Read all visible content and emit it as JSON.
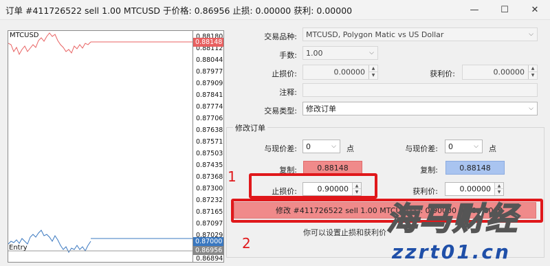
{
  "window": {
    "title": "订单 #411726522 sell 1.00 MTCUSD 于价格: 0.86956 止损: 0.00000 获利: 0.00000",
    "minimize": "—",
    "maximize": "☐",
    "close": "✕"
  },
  "chart": {
    "symbol": "MTCUSD",
    "entry_label": "Entry",
    "ticks": [
      "0.88180",
      "0.88112",
      "0.88044",
      "0.87977",
      "0.87909",
      "0.87841",
      "0.87774",
      "0.87706",
      "0.87638",
      "0.87571",
      "0.87503",
      "0.87435",
      "0.87368",
      "0.87300",
      "0.87232",
      "0.87165",
      "0.87097",
      "0.87029",
      "0.86956",
      "0.86894"
    ],
    "bid_tag": "0.88148",
    "entry_tag": "0.87000",
    "price_tag": "0.86956",
    "colors": {
      "bid": "#e86060",
      "entry": "#3a78c0",
      "price_line": "#888888"
    }
  },
  "form": {
    "symbol_label": "交易品种:",
    "symbol_value": "MTCUSD, Polygon Matic vs US Dollar",
    "volume_label": "手数:",
    "volume_value": "1.00",
    "sl_label": "止损价:",
    "sl_value": "0.00000",
    "tp_label": "获利价:",
    "tp_value": "0.00000",
    "comment_label": "注释:",
    "comment_value": "",
    "type_label": "交易类型:",
    "type_value": "修改订单"
  },
  "modify_group": {
    "title": "修改订单",
    "diff_label_left": "与现价差:",
    "diff_value_left": "0",
    "diff_label_right": "与现价差:",
    "diff_value_right": "0",
    "points_unit_left": "点",
    "points_unit_right": "点",
    "copy_label_left": "复制:",
    "copy_value_left": "0.88148",
    "copy_label_right": "复制:",
    "copy_value_right": "0.88148",
    "sl_label": "止损价:",
    "sl_value": "0.90000",
    "tp_label": "获利价:",
    "tp_value": "0.00000",
    "modify_button": "修改 #411726522 sell 1.00 MTCUSD sl: 0.90000 tp: 0.00000",
    "hint": "你可以设置止损和获利价"
  },
  "annotations": {
    "one": "1",
    "two": "2",
    "color": "#e0181b"
  },
  "watermark": {
    "top_text": "海马财经",
    "bottom_text": "zzrt01.cn"
  }
}
